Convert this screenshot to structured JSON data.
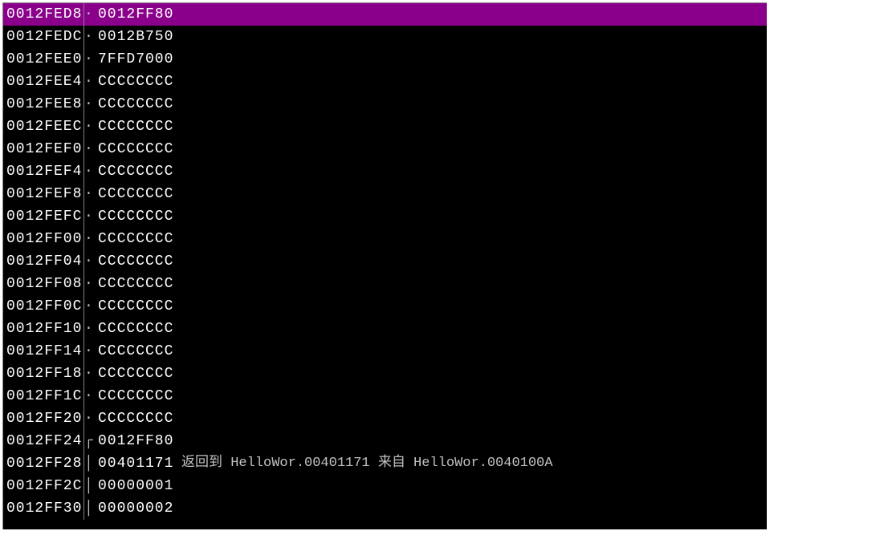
{
  "stack": {
    "selected_index": 0,
    "rows": [
      {
        "addr": "0012FED8",
        "sep": "·",
        "val": "0012FF80",
        "comment": ""
      },
      {
        "addr": "0012FEDC",
        "sep": "·",
        "val": "0012B750",
        "comment": ""
      },
      {
        "addr": "0012FEE0",
        "sep": "·",
        "val": "7FFD7000",
        "comment": ""
      },
      {
        "addr": "0012FEE4",
        "sep": "·",
        "val": "CCCCCCCC",
        "comment": ""
      },
      {
        "addr": "0012FEE8",
        "sep": "·",
        "val": "CCCCCCCC",
        "comment": ""
      },
      {
        "addr": "0012FEEC",
        "sep": "·",
        "val": "CCCCCCCC",
        "comment": ""
      },
      {
        "addr": "0012FEF0",
        "sep": "·",
        "val": "CCCCCCCC",
        "comment": ""
      },
      {
        "addr": "0012FEF4",
        "sep": "·",
        "val": "CCCCCCCC",
        "comment": ""
      },
      {
        "addr": "0012FEF8",
        "sep": "·",
        "val": "CCCCCCCC",
        "comment": ""
      },
      {
        "addr": "0012FEFC",
        "sep": "·",
        "val": "CCCCCCCC",
        "comment": ""
      },
      {
        "addr": "0012FF00",
        "sep": "·",
        "val": "CCCCCCCC",
        "comment": ""
      },
      {
        "addr": "0012FF04",
        "sep": "·",
        "val": "CCCCCCCC",
        "comment": ""
      },
      {
        "addr": "0012FF08",
        "sep": "·",
        "val": "CCCCCCCC",
        "comment": ""
      },
      {
        "addr": "0012FF0C",
        "sep": "·",
        "val": "CCCCCCCC",
        "comment": ""
      },
      {
        "addr": "0012FF10",
        "sep": "·",
        "val": "CCCCCCCC",
        "comment": ""
      },
      {
        "addr": "0012FF14",
        "sep": "·",
        "val": "CCCCCCCC",
        "comment": ""
      },
      {
        "addr": "0012FF18",
        "sep": "·",
        "val": "CCCCCCCC",
        "comment": ""
      },
      {
        "addr": "0012FF1C",
        "sep": "·",
        "val": "CCCCCCCC",
        "comment": ""
      },
      {
        "addr": "0012FF20",
        "sep": "·",
        "val": "CCCCCCCC",
        "comment": ""
      },
      {
        "addr": "0012FF24",
        "sep": "┌",
        "val": "0012FF80",
        "comment": ""
      },
      {
        "addr": "0012FF28",
        "sep": "│",
        "val": "00401171",
        "comment": "返回到 HelloWor.00401171 来自 HelloWor.0040100A"
      },
      {
        "addr": "0012FF2C",
        "sep": "│",
        "val": "00000001",
        "comment": ""
      },
      {
        "addr": "0012FF30",
        "sep": "│",
        "val": "00000002",
        "comment": ""
      }
    ]
  }
}
